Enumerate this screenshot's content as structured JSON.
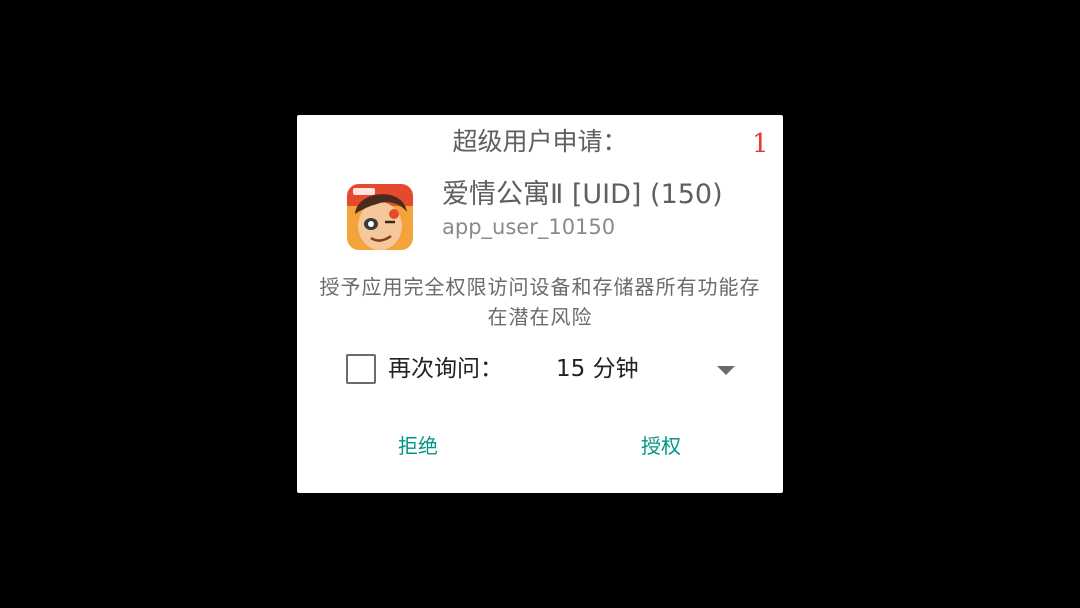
{
  "dialog": {
    "title": "超级用户申请：",
    "counter": "1",
    "app": {
      "name": "爱情公寓Ⅱ [UID] (150)",
      "user": "app_user_10150",
      "icon": "cartoon-boy-app-icon"
    },
    "message": "授予应用完全权限访问设备和存储器所有功能存在潜在风险",
    "remember": {
      "label": "再次询问：",
      "checked": false,
      "duration": "15 分钟"
    },
    "buttons": {
      "deny": "拒绝",
      "grant": "授权"
    },
    "colors": {
      "accent": "#009688",
      "counter": "#e53935",
      "background": "#000000",
      "dialog": "#ffffff"
    }
  }
}
